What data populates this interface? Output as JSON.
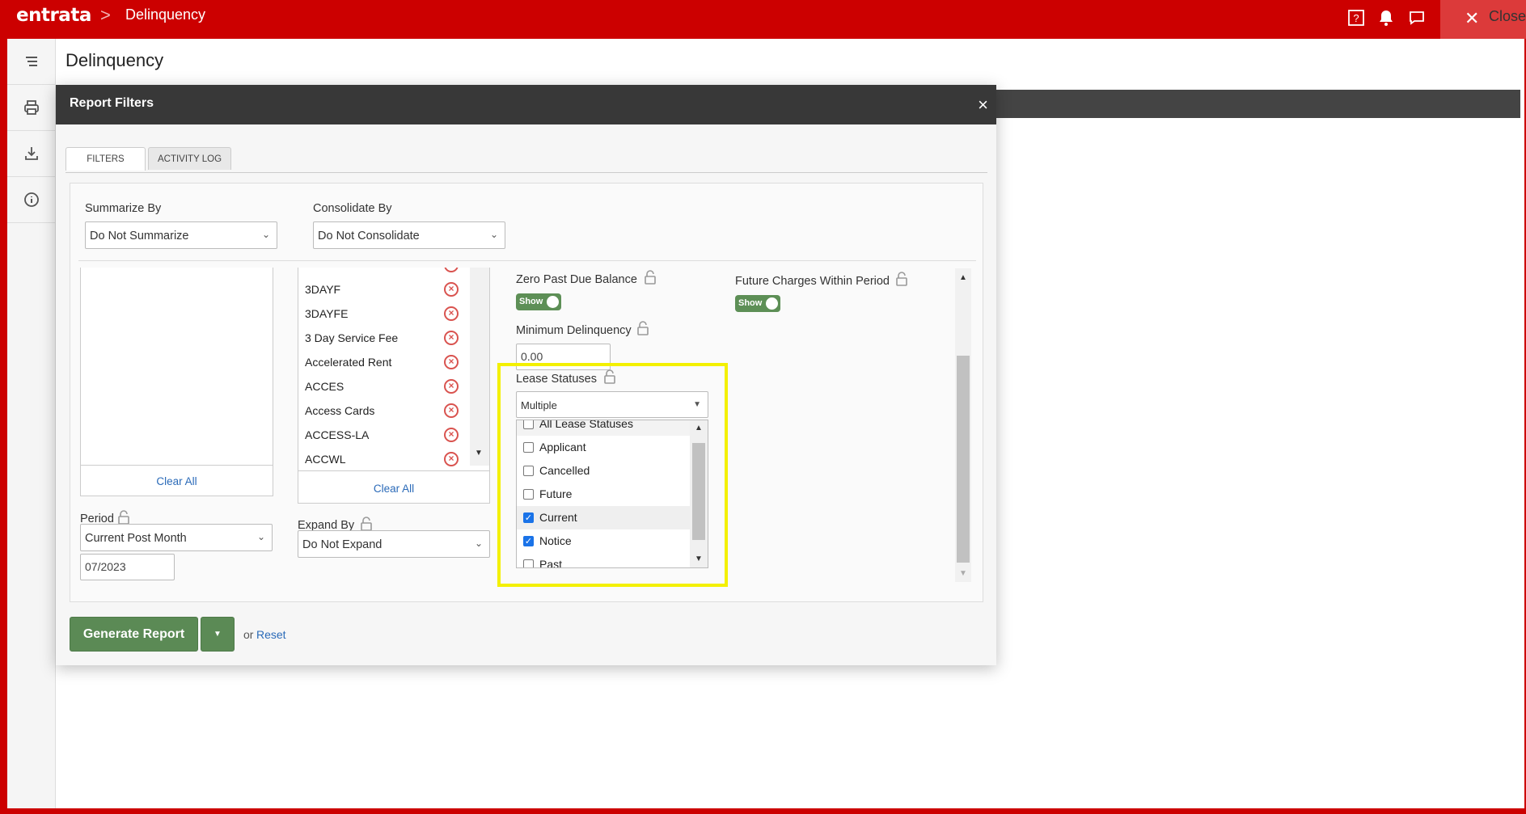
{
  "topbar": {
    "logo": "entrata",
    "breadcrumb_sep": ">",
    "breadcrumb": "Delinquency",
    "icons": [
      "help-icon",
      "bell-icon",
      "chat-icon"
    ],
    "close_label": "Close"
  },
  "page": {
    "title": "Delinquency"
  },
  "sidebar": {
    "icons": [
      "menu-icon",
      "print-icon",
      "download-icon",
      "info-icon"
    ]
  },
  "modal": {
    "title": "Report Filters",
    "close": "×",
    "tabs": [
      {
        "label": "FILTERS",
        "active": true
      },
      {
        "label": "ACTIVITY LOG",
        "active": false
      }
    ]
  },
  "filters": {
    "summarize_by": {
      "label": "Summarize By",
      "value": "Do Not Summarize"
    },
    "consolidate_by": {
      "label": "Consolidate By",
      "value": "Do Not Consolidate"
    },
    "clear_all": "Clear All",
    "charge_codes": [
      "3DAYF",
      "3DAYFE",
      "3 Day Service Fee",
      "Accelerated Rent",
      "ACCES",
      "Access Cards",
      "ACCESS-LA",
      "ACCWL"
    ],
    "charge_clear_all": "Clear All",
    "period": {
      "label": "Period",
      "value": "Current Post Month",
      "date": "07/2023"
    },
    "expand_by": {
      "label": "Expand By",
      "value": "Do Not Expand"
    },
    "zero_past_due": {
      "label": "Zero Past Due Balance",
      "toggle": "Show"
    },
    "future_charges": {
      "label": "Future Charges Within Period",
      "toggle": "Show"
    },
    "min_delinquency": {
      "label": "Minimum Delinquency",
      "value": "0.00"
    },
    "lease_statuses": {
      "label": "Lease Statuses",
      "value": "Multiple",
      "options": [
        {
          "label": "All Lease Statuses",
          "checked": false
        },
        {
          "label": "Applicant",
          "checked": false
        },
        {
          "label": "Cancelled",
          "checked": false
        },
        {
          "label": "Future",
          "checked": false
        },
        {
          "label": "Current",
          "checked": true
        },
        {
          "label": "Notice",
          "checked": true
        },
        {
          "label": "Past",
          "checked": false
        }
      ]
    }
  },
  "footer": {
    "generate": "Generate Report",
    "or": "or",
    "reset": "Reset"
  },
  "colors": {
    "brand": "#cc0000",
    "primary_button": "#5b8a55",
    "highlight": "#f3f000",
    "link": "#2a6ab8"
  }
}
